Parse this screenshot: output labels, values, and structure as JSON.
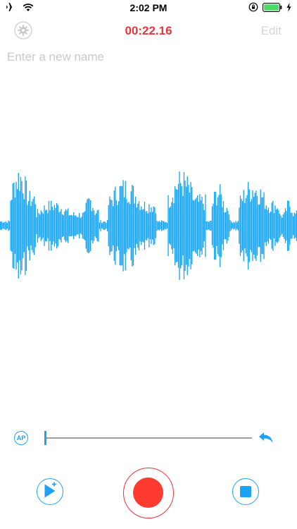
{
  "status": {
    "time": "2:02 PM"
  },
  "nav": {
    "timer": "00:22.16",
    "edit_label": "Edit"
  },
  "name_field": {
    "placeholder": "Enter a new name",
    "value": ""
  },
  "scrubber": {
    "ap_label": "AP",
    "position_fraction": 0
  },
  "controls": {
    "record_state": "idle"
  },
  "icons": {
    "airplane": "airplane-icon",
    "wifi": "wifi-icon",
    "orientation_lock": "orientation-lock-icon",
    "battery": "battery-icon",
    "charging": "charging-bolt-icon",
    "settings": "gear-icon",
    "undo": "undo-arrow-icon",
    "play_add": "play-add-icon",
    "stop": "stop-icon",
    "record": "record-icon"
  },
  "colors": {
    "accent_blue": "#1da1f2",
    "waveform": "#12a4f5",
    "timer_red": "#e8343a",
    "record_red": "#ff3b30",
    "battery_green": "#4cd964",
    "muted_gray": "#c9c9c9"
  }
}
